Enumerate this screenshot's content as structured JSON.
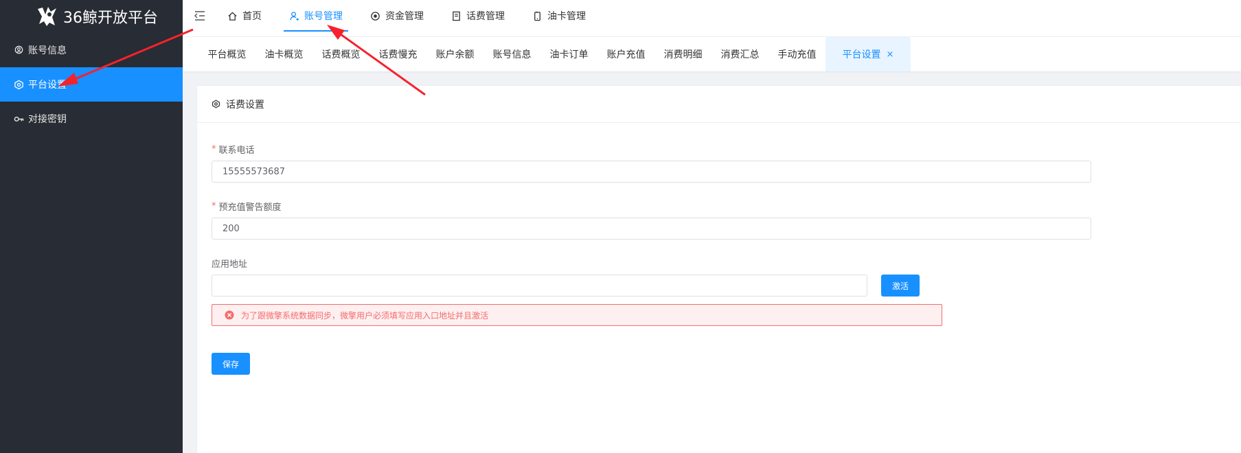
{
  "brand": {
    "name": "36鲸开放平台"
  },
  "sidebar": {
    "items": [
      {
        "label": "账号信息",
        "icon": "location-pin-icon",
        "active": false
      },
      {
        "label": "平台设置",
        "icon": "settings-hexagon-icon",
        "active": true
      },
      {
        "label": "对接密钥",
        "icon": "key-icon",
        "active": false
      }
    ]
  },
  "topnav": {
    "items": [
      {
        "label": "首页",
        "icon": "home-icon",
        "active": false
      },
      {
        "label": "账号管理",
        "icon": "user-icon",
        "active": true
      },
      {
        "label": "资金管理",
        "icon": "record-icon",
        "active": false
      },
      {
        "label": "话费管理",
        "icon": "document-icon",
        "active": false
      },
      {
        "label": "油卡管理",
        "icon": "mobile-icon",
        "active": false
      }
    ]
  },
  "tabs": [
    {
      "label": "平台概览"
    },
    {
      "label": "油卡概览"
    },
    {
      "label": "话费概览"
    },
    {
      "label": "话费慢充"
    },
    {
      "label": "账户余额"
    },
    {
      "label": "账号信息"
    },
    {
      "label": "油卡订单"
    },
    {
      "label": "账户充值"
    },
    {
      "label": "消费明细"
    },
    {
      "label": "消费汇总"
    },
    {
      "label": "手动充值"
    },
    {
      "label": "平台设置",
      "active": true,
      "close": "×"
    }
  ],
  "card": {
    "title": "话费设置",
    "phone": {
      "label": "联系电话",
      "required_mark": "*",
      "value": "15555573687"
    },
    "warning_amount": {
      "label": "预充值警告额度",
      "required_mark": "*",
      "value": "200"
    },
    "app_address": {
      "label": "应用地址",
      "value": ""
    },
    "activate_label": "激活",
    "alert": "为了跟微擎系统数据同步，微擎用户必须填写应用入口地址并且激活",
    "save_label": "保存"
  },
  "colors": {
    "accent": "#1890ff",
    "sidebar_bg": "#282c34",
    "error": "#f56c6c",
    "annotation": "#f5222d"
  }
}
